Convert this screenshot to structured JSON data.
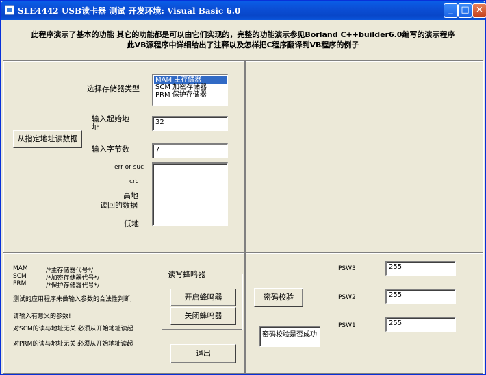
{
  "window": {
    "title": "SLE4442 USB读卡器 测试  开发环境: Visual Basic 6.0",
    "minimize": "_",
    "maximize": "□",
    "close": "×"
  },
  "notice": {
    "line1": "此程序演示了基本的功能 其它的功能都是可以由它们实现的，完整的功能演示参见Borland C++builder6.0编写的演示程序",
    "line2": "此VB源程序中详细给出了注释以及怎样把C程序翻译到VB程序的例子"
  },
  "read_panel": {
    "storage_type_label": "选择存储器类型",
    "storage_options": [
      "MAM 主存储器",
      "SCM 加密存储器",
      "PRM 保护存储器"
    ],
    "selected_index": 0,
    "start_address_label": "输入起始地址",
    "start_address_value": "32",
    "byte_count_label": "输入字节数",
    "byte_count_value": "7",
    "read_button": "从指定地址读数据",
    "err_label": "err or suc",
    "crc_label": "crc",
    "high_label": "高地",
    "readback_label": "读回的数据",
    "low_label": "低地"
  },
  "info_panel": {
    "mam_code": "MAM",
    "mam_desc": "/*主存储器代号*/",
    "scm_code": "SCM",
    "scm_desc": "/*加密存储器代号*/",
    "prm_code": "PRM",
    "prm_desc": "/*保护存储器代号*/",
    "warn1": "测试的应用程序未做输入参数的合法性判断,",
    "warn2": "请输入有意义的参数!",
    "scm_note": "对SCM的读与地址无关 必须从开始地址读起",
    "prm_note": "对PRM的读与地址无关 必须从开始地址读起"
  },
  "buzzer": {
    "group_title": "读写蜂鸣器",
    "on_button": "开启蜂鸣器",
    "off_button": "关闭蜂鸣器",
    "exit_button": "退出"
  },
  "password": {
    "verify_button": "密码校验",
    "result_text": "密码校验是否成功",
    "psw3_label": "PSW3",
    "psw3_value": "255",
    "psw2_label": "PSW2",
    "psw2_value": "255",
    "psw1_label": "PSW1",
    "psw1_value": "255"
  }
}
